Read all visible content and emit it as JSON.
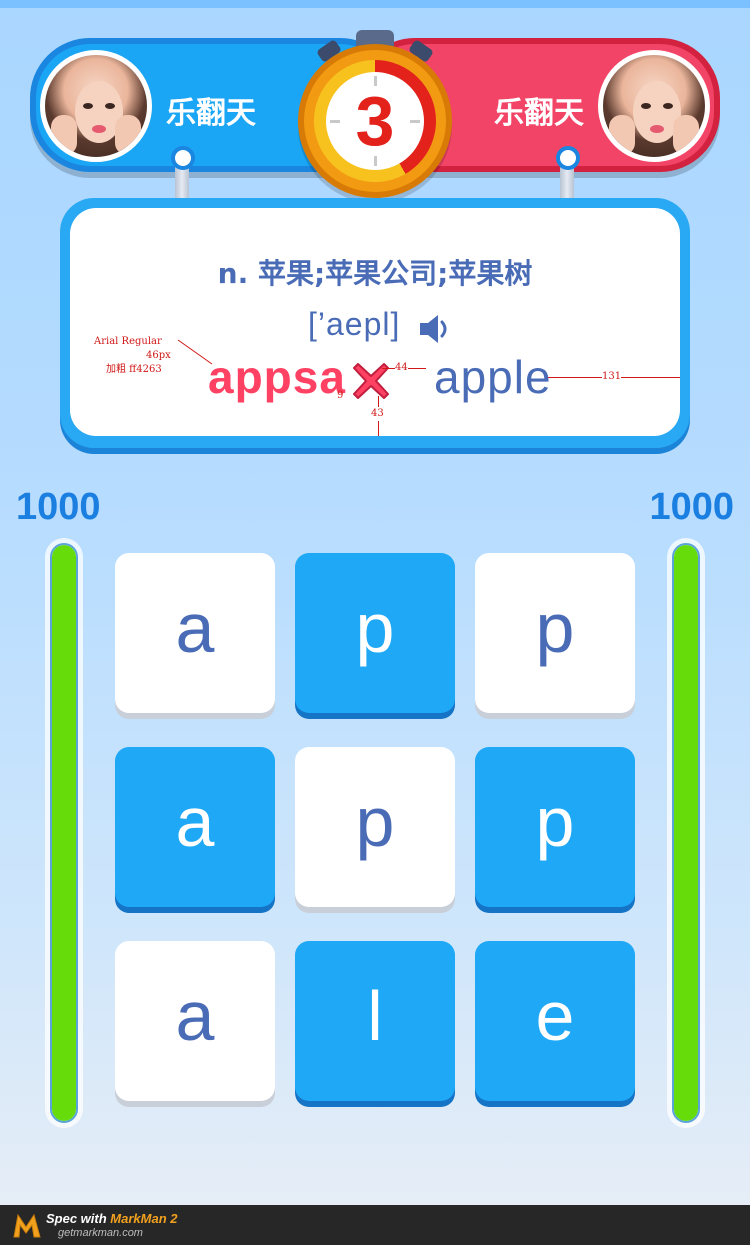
{
  "players": {
    "left": {
      "name": "乐翻天",
      "score": "1000",
      "progress": 1.0
    },
    "right": {
      "name": "乐翻天",
      "score": "1000",
      "progress": 1.0
    }
  },
  "timer": {
    "value": "3"
  },
  "question": {
    "definition": "n. 苹果;苹果公司;苹果树",
    "phonetic": "[’aepl]",
    "wrong_answer": "appsa",
    "correct_answer": "apple"
  },
  "tiles": [
    {
      "letter": "a",
      "style": "white"
    },
    {
      "letter": "p",
      "style": "blue"
    },
    {
      "letter": "p",
      "style": "white"
    },
    {
      "letter": "a",
      "style": "blue"
    },
    {
      "letter": "p",
      "style": "white"
    },
    {
      "letter": "p",
      "style": "blue"
    },
    {
      "letter": "a",
      "style": "white"
    },
    {
      "letter": "l",
      "style": "blue"
    },
    {
      "letter": "e",
      "style": "blue"
    }
  ],
  "spec": {
    "font_line1": "Arial Regular",
    "font_line2": "46px",
    "font_line3": "加粗 ff4263",
    "gap_44": "44",
    "gap_131": "131",
    "gap_9": "9",
    "gap_43": "43"
  },
  "footer": {
    "prefix": "Spec with ",
    "brand": "MarkMan 2",
    "url": "getmarkman.com"
  },
  "colors": {
    "blue": "#1ea8f5",
    "red": "#f24466",
    "wrong": "#ff4263",
    "text": "#4a6cb6",
    "progress": "#66dd0a"
  }
}
